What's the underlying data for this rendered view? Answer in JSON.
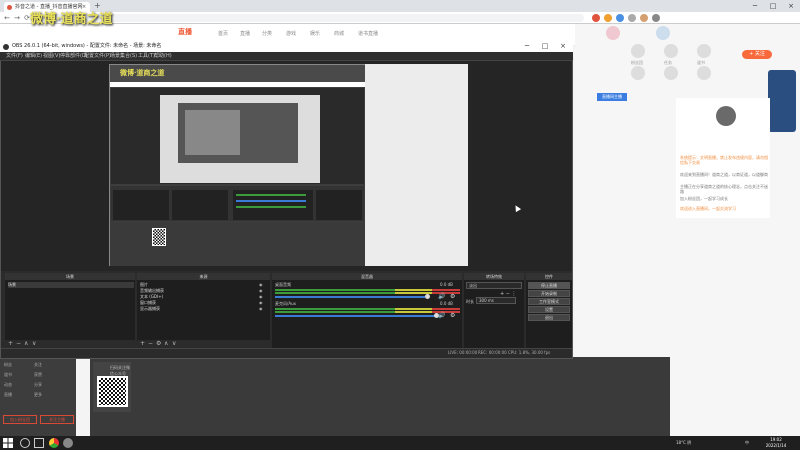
{
  "browser": {
    "tab_title": "抖音之道 - 直播_抖音直播官网",
    "tab_close": "×",
    "new_tab": "+",
    "window_controls": [
      "─",
      "□",
      "×"
    ],
    "nav_icons": [
      "←",
      "→",
      "⟳",
      "⌂"
    ],
    "url": ""
  },
  "overlay": {
    "title": "微博·道商之道",
    "captured_title": "微博·道商之道"
  },
  "site": {
    "logo": "直播",
    "nav": [
      "首页",
      "直播",
      "分类",
      "游戏",
      "娱乐",
      "商城",
      "道书直播"
    ],
    "follow_label": "+ 关注",
    "live_badge": "直播间主播",
    "right_icons": [
      "粉丝团",
      "任务",
      "道书",
      "分享",
      "关注",
      "更多"
    ]
  },
  "chat": {
    "lines": [
      "系统提示：文明直播，禁止发布违规内容，请勿相信私下交易",
      "欢迎来到直播间！道商之道，以商证道，以道御商",
      "主播正在分享道商之道的核心理念，点击关注不迷路",
      "加入粉丝团，一起学习成长"
    ],
    "footer": "欢迎进入直播间，一起交流学习"
  },
  "left_panel": {
    "rows": [
      "粉丝",
      "关注",
      "道书",
      "获赞",
      "动态",
      "分享",
      "直播",
      "更多"
    ],
    "btn1": "加入粉丝团",
    "btn2": "关注主播",
    "qr_caption": "扫码关注微信公众号"
  },
  "obs": {
    "title": "OBS 26.0.1 (64-bit, windows) - 配置文件: 未命名 - 场景: 未命名",
    "menu": [
      "文件(F)",
      "编辑(E)",
      "视图(V)",
      "停靠部件(D)",
      "配置文件(P)",
      "场景集合(S)",
      "工具(T)",
      "帮助(H)"
    ],
    "docks": {
      "scenes": {
        "title": "场景",
        "items": [
          "场景"
        ]
      },
      "sources": {
        "title": "来源",
        "items": [
          "图片",
          "音频输出捕获",
          "文本 (GDI+)",
          "窗口捕获",
          "显示器捕获"
        ]
      },
      "mixer": {
        "title": "混音器",
        "channels": [
          {
            "name": "桌面音频",
            "db": "0.0 dB"
          },
          {
            "name": "麦克风/Aux",
            "db": "0.0 dB"
          }
        ]
      },
      "transitions": {
        "title": "转场特效",
        "selected": "淡出",
        "duration_label": "时长",
        "duration": "300 ms"
      },
      "controls": {
        "title": "控件",
        "buttons": [
          "停止直播",
          "开始录制",
          "工作室模式",
          "设置",
          "退出"
        ]
      }
    },
    "tools": [
      "+",
      "−",
      "∧",
      "∨"
    ],
    "status": {
      "live": "LIVE: 00:00:00",
      "rec": "REC: 00:00:00",
      "cpu": "CPU: 1.8%, 30.00 fps",
      "kbps": "kb/s: 2500"
    }
  },
  "taskbar": {
    "weather": "18°C 阴",
    "time": "19:02",
    "date": "2022/1/14",
    "lang": "中"
  }
}
